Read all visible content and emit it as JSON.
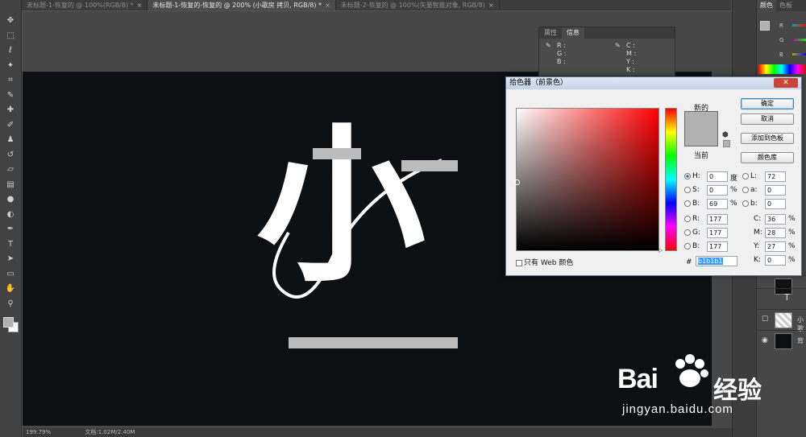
{
  "tabs": [
    {
      "label": "未标题-1-恢复的 @ 100%(RGB/8) *",
      "active": false
    },
    {
      "label": "未标题-1-恢复的-恢复的 @ 200% (小歌房 拷贝, RGB/8) *",
      "active": true
    },
    {
      "label": "未标题-2-恢复的 @ 100%(矢量智能对象, RGB/8)",
      "active": false
    }
  ],
  "tab_close": "×",
  "tools": [
    {
      "name": "move-tool-icon",
      "glyph": "✥"
    },
    {
      "name": "marquee-tool-icon",
      "glyph": "⬚"
    },
    {
      "name": "lasso-tool-icon",
      "glyph": "ℓ"
    },
    {
      "name": "magic-wand-icon",
      "glyph": "✦"
    },
    {
      "name": "crop-tool-icon",
      "glyph": "⌗"
    },
    {
      "name": "eyedropper-tool-icon",
      "glyph": "✎"
    },
    {
      "name": "healing-brush-icon",
      "glyph": "✚"
    },
    {
      "name": "brush-tool-icon",
      "glyph": "✐"
    },
    {
      "name": "stamp-tool-icon",
      "glyph": "♟"
    },
    {
      "name": "history-brush-icon",
      "glyph": "↺"
    },
    {
      "name": "eraser-tool-icon",
      "glyph": "▱"
    },
    {
      "name": "gradient-tool-icon",
      "glyph": "▤"
    },
    {
      "name": "blur-tool-icon",
      "glyph": "●"
    },
    {
      "name": "dodge-tool-icon",
      "glyph": "◐"
    },
    {
      "name": "pen-tool-icon",
      "glyph": "✒"
    },
    {
      "name": "type-tool-icon",
      "glyph": "T"
    },
    {
      "name": "path-select-icon",
      "glyph": "➤"
    },
    {
      "name": "shape-tool-icon",
      "glyph": "▭"
    },
    {
      "name": "hand-tool-icon",
      "glyph": "✋"
    },
    {
      "name": "zoom-tool-icon",
      "glyph": "⚲"
    }
  ],
  "status": {
    "zoom": "199.79%",
    "doc": "文档:1.02M/2.40M"
  },
  "info_panel": {
    "tabs": [
      "属性",
      "信息"
    ],
    "rgb": [
      "R :",
      "G :",
      "B :"
    ],
    "cmyk": [
      "C :",
      "M :",
      "Y :",
      "K :"
    ]
  },
  "right_panel": {
    "tabs": [
      "颜色",
      "色板"
    ],
    "slider_labels": [
      "R",
      "G",
      "B"
    ],
    "layer_names": [
      "",
      "",
      "小歌",
      "背"
    ],
    "layer_type_glyph": "T"
  },
  "dialog": {
    "title": "拾色器（前景色）",
    "close": "✕",
    "new_label": "新的",
    "current_label": "当前",
    "cube_glyph": "⬢",
    "buttons": {
      "ok": "确定",
      "cancel": "取消",
      "add_swatch": "添加到色板",
      "library": "颜色库"
    },
    "hsb": [
      {
        "label": "H:",
        "value": "0",
        "unit": "度",
        "selected": true
      },
      {
        "label": "S:",
        "value": "0",
        "unit": "%",
        "selected": false
      },
      {
        "label": "B:",
        "value": "69",
        "unit": "%",
        "selected": false
      }
    ],
    "rgb": [
      {
        "label": "R:",
        "value": "177"
      },
      {
        "label": "G:",
        "value": "177"
      },
      {
        "label": "B:",
        "value": "177"
      }
    ],
    "lab": [
      {
        "label": "L:",
        "value": "72"
      },
      {
        "label": "a:",
        "value": "0"
      },
      {
        "label": "b:",
        "value": "0"
      }
    ],
    "cmyk": [
      {
        "label": "C:",
        "value": "36",
        "unit": "%"
      },
      {
        "label": "M:",
        "value": "28",
        "unit": "%"
      },
      {
        "label": "Y:",
        "value": "27",
        "unit": "%"
      },
      {
        "label": "K:",
        "value": "0",
        "unit": "%"
      }
    ],
    "web_only": "只有 Web 颜色",
    "hex_label": "#",
    "hex_value": "b1b1b1",
    "hue_level": 0,
    "selected_color": "#b1b1b1"
  },
  "canvas": {
    "artwork_text": "小歌房",
    "bg_color": "#0c1013"
  },
  "watermark": {
    "brand": "Bai",
    "brand2": "经验",
    "url": "jingyan.baidu.com"
  }
}
